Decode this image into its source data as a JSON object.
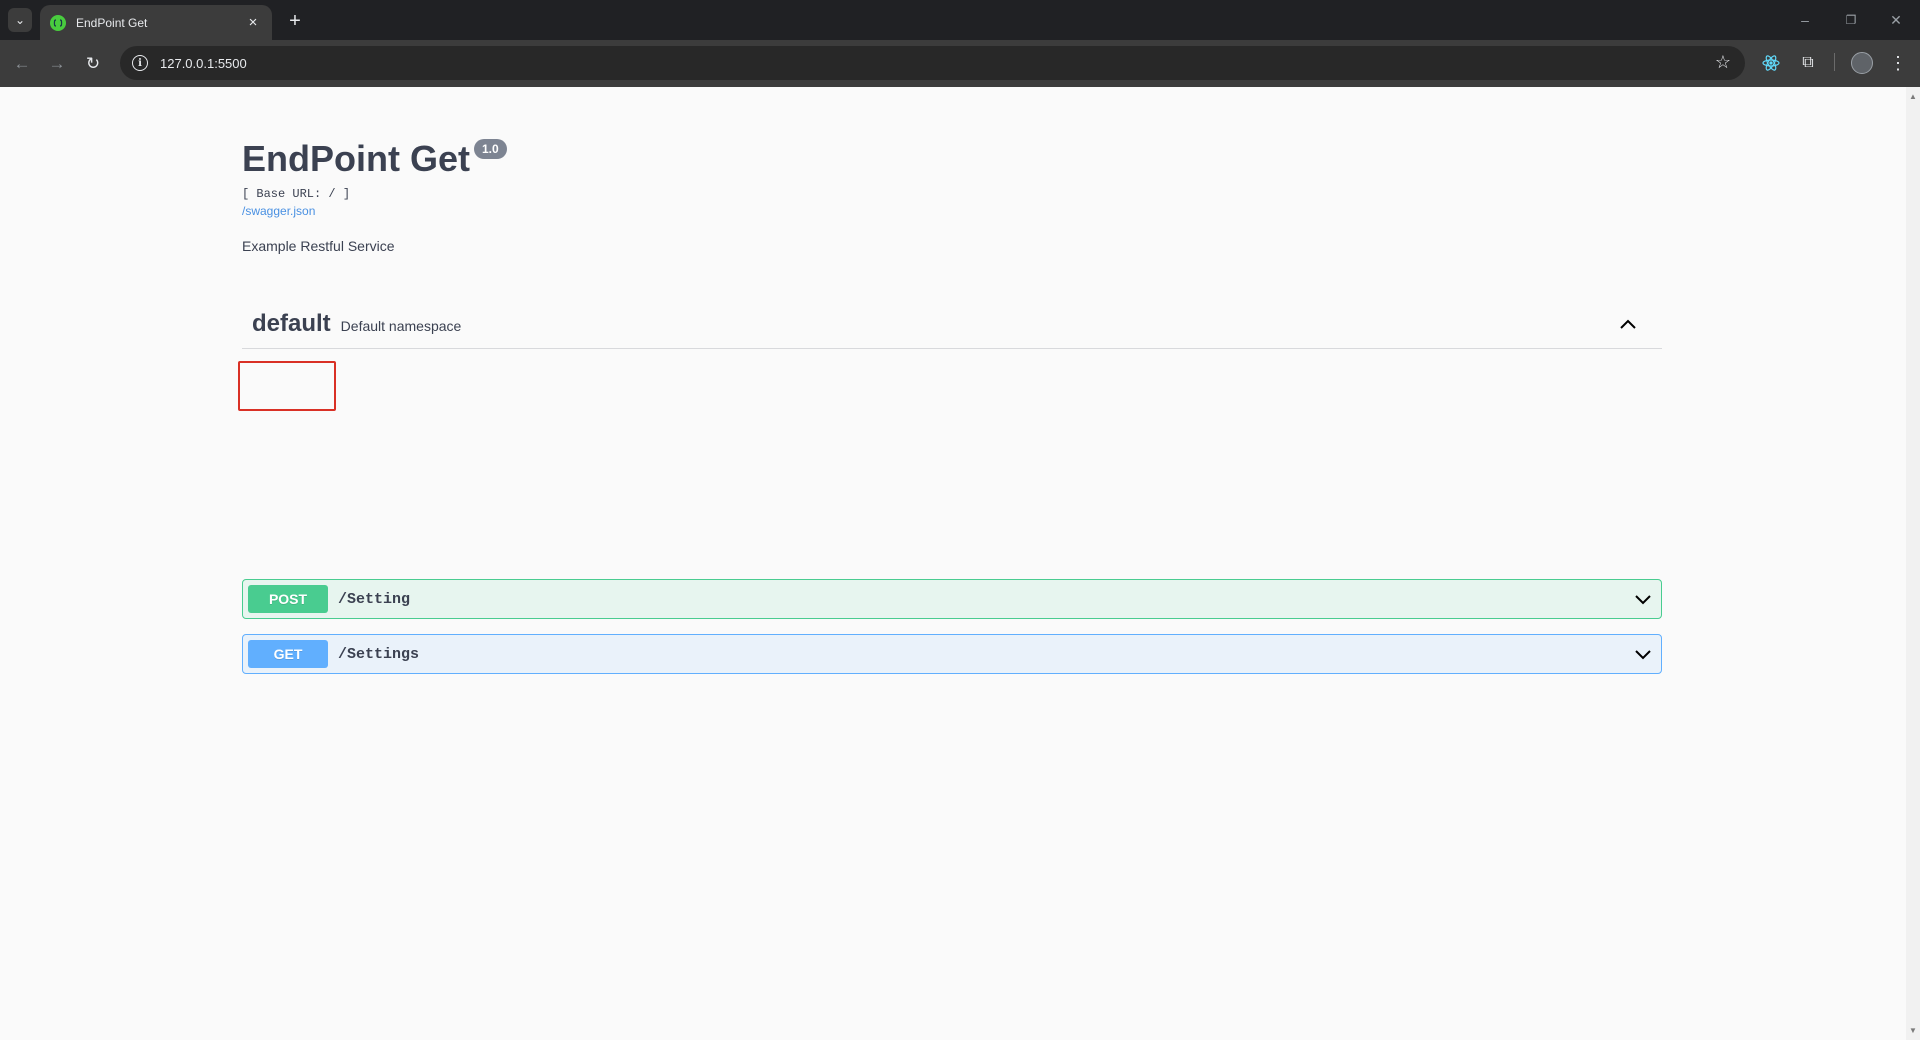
{
  "browser": {
    "tab_title": "EndPoint Get",
    "tab_close": "×",
    "new_tab": "+",
    "url": "127.0.0.1:5500",
    "info_glyph": "i",
    "star": "☆",
    "tab_list": "⌄",
    "back": "←",
    "forward": "→",
    "reload": "↻",
    "minimize": "–",
    "restore": "❐",
    "close": "✕",
    "extensions": "⧉",
    "menu": "⋮"
  },
  "api": {
    "title": "EndPoint Get",
    "version": "1.0",
    "base_url": "[ Base URL: / ]",
    "spec_link": "/swagger.json",
    "description": "Example Restful Service"
  },
  "tag": {
    "name": "default",
    "description": "Default namespace"
  },
  "operations": [
    {
      "method": "POST",
      "path": "/Setting",
      "color": "#49cc90"
    },
    {
      "method": "GET",
      "path": "/Settings",
      "color": "#61affe"
    }
  ],
  "highlight_color": "#d93025"
}
